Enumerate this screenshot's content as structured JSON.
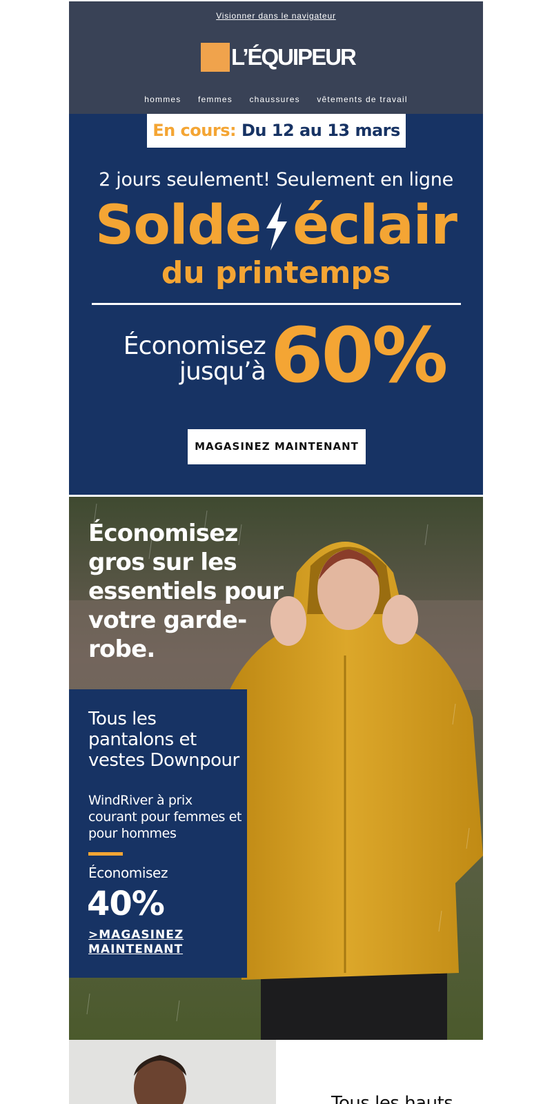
{
  "header": {
    "view_in_browser": "Visionner dans le navigateur",
    "logo_text": "L’ÉQUIPEUR",
    "nav": [
      "hommes",
      "femmes",
      "chaussures",
      "vêtements de travail"
    ]
  },
  "hero": {
    "date_label": "En cours:",
    "date_value": "Du 12 au 13 mars",
    "tagline": "2 jours seulement! Seulement en ligne",
    "title_part1": "Solde",
    "title_part2": "éclair",
    "subtitle": "du printemps",
    "save_line1": "Économisez",
    "save_line2": "jusqu’à",
    "save_percent": "60%",
    "cta": "MAGASINEZ MAINTENANT"
  },
  "jacket_section": {
    "headline": "Économisez gros sur les essentiels pour votre garde-robe.",
    "promo_title": "Tous les pantalons et vestes Downpour",
    "promo_description": "WindRiver à prix courant pour femmes et pour hommes",
    "save_label": "Économisez",
    "save_percent": "40%",
    "link": ">MAGASINEZ MAINTENANT"
  },
  "bottom_section": {
    "title": "Tous les hauts"
  },
  "colors": {
    "header_bg": "#394256",
    "navy": "#173364",
    "orange": "#f4a534",
    "logo_orange": "#f0a34c",
    "jacket_yellow": "#d9a21b"
  },
  "icons": [
    "lightning-bolt-icon"
  ]
}
